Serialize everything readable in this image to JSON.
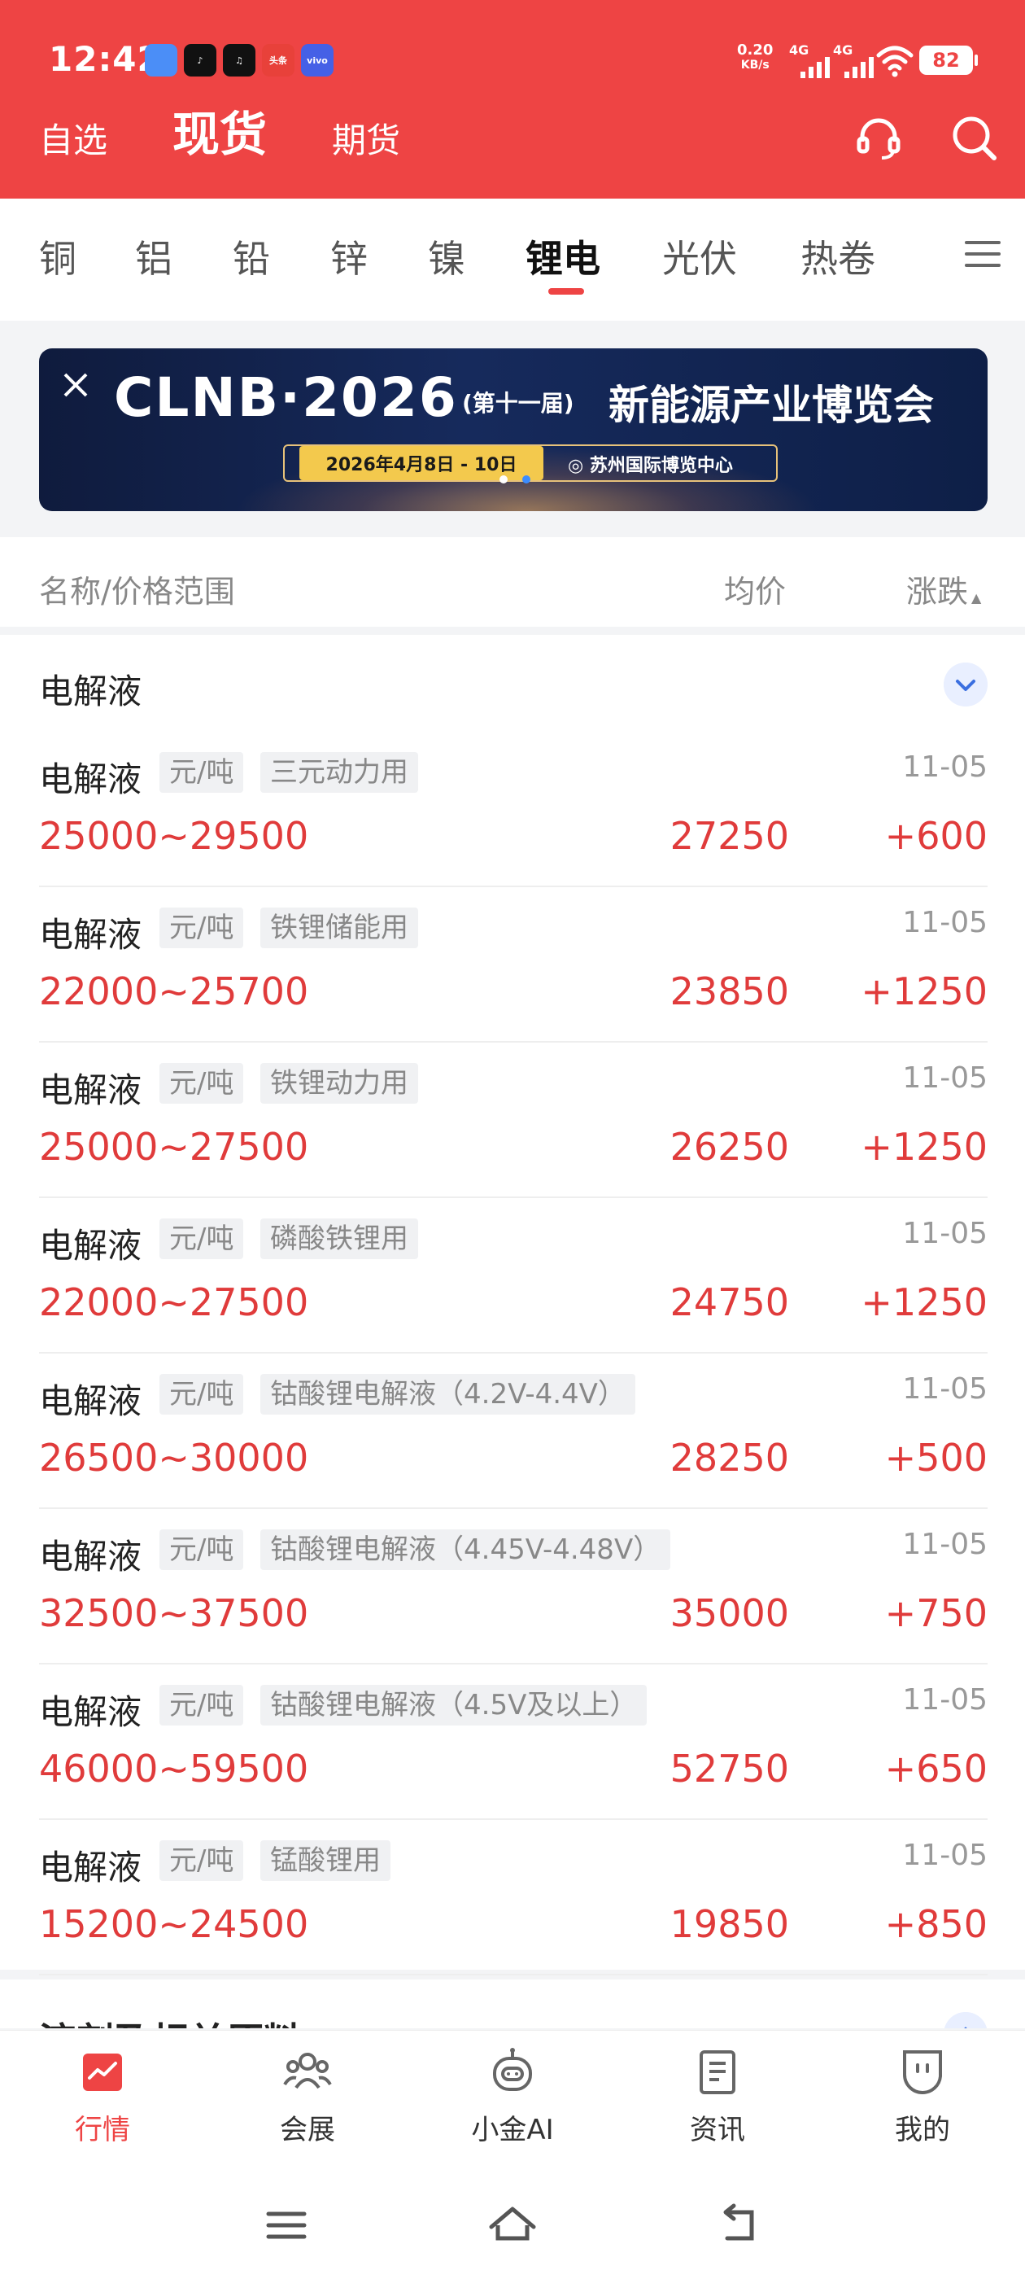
{
  "status_bar": {
    "time": "12:42",
    "net_speed_value": "0.20",
    "net_speed_unit": "KB/s",
    "signal1": "4G",
    "signal2": "4G",
    "battery": "82",
    "app_icons": [
      {
        "name": "maps-app-icon",
        "text": "",
        "color": "#4b8ef7"
      },
      {
        "name": "tiktok-app-icon",
        "text": "♪",
        "color": "#111111"
      },
      {
        "name": "music-app-icon",
        "text": "♫",
        "color": "#111111"
      },
      {
        "name": "toutiao-app-icon",
        "text": "头条",
        "color": "#e8413a"
      },
      {
        "name": "vivo-app-icon",
        "text": "vivo",
        "color": "#4560e6"
      }
    ]
  },
  "header": {
    "tabs": [
      "自选",
      "现货",
      "期货"
    ],
    "active_tab": "现货"
  },
  "categories": {
    "items": [
      "铜",
      "铝",
      "铅",
      "锌",
      "镍",
      "锂电",
      "光伏",
      "热卷"
    ],
    "active": "锂电"
  },
  "banner": {
    "brand": "CLNB·2026",
    "edition": "(第十一届)",
    "expo": "新能源产业博览会",
    "date": "2026年4月8日 - 10日",
    "venue": "苏州国际博览中心"
  },
  "table_header": {
    "name": "名称/价格范围",
    "avg": "均价",
    "change": "涨跌"
  },
  "section": {
    "title": "电解液",
    "unit": "元/吨",
    "rows": [
      {
        "name": "电解液",
        "spec": "三元动力用",
        "date": "11-05",
        "range": "25000~29500",
        "avg": "27250",
        "change": "+600"
      },
      {
        "name": "电解液",
        "spec": "铁锂储能用",
        "date": "11-05",
        "range": "22000~25700",
        "avg": "23850",
        "change": "+1250"
      },
      {
        "name": "电解液",
        "spec": "铁锂动力用",
        "date": "11-05",
        "range": "25000~27500",
        "avg": "26250",
        "change": "+1250"
      },
      {
        "name": "电解液",
        "spec": "磷酸铁锂用",
        "date": "11-05",
        "range": "22000~27500",
        "avg": "24750",
        "change": "+1250"
      },
      {
        "name": "电解液",
        "spec": "钴酸锂电解液（4.2V-4.4V）",
        "date": "11-05",
        "range": "26500~30000",
        "avg": "28250",
        "change": "+500"
      },
      {
        "name": "电解液",
        "spec": "钴酸锂电解液（4.45V-4.48V）",
        "date": "11-05",
        "range": "32500~37500",
        "avg": "35000",
        "change": "+750"
      },
      {
        "name": "电解液",
        "spec": "钴酸锂电解液（4.5V及以上）",
        "date": "11-05",
        "range": "46000~59500",
        "avg": "52750",
        "change": "+650"
      },
      {
        "name": "电解液",
        "spec": "锰酸锂用",
        "date": "11-05",
        "range": "15200~24500",
        "avg": "19850",
        "change": "+850"
      }
    ]
  },
  "next_section": {
    "title": "溶剂及相关原料"
  },
  "bottom_nav": {
    "items": [
      "行情",
      "会展",
      "小金AI",
      "资讯",
      "我的"
    ],
    "active": "行情"
  },
  "colors": {
    "brand_red": "#ee4444",
    "price_red": "#e03b3b"
  }
}
